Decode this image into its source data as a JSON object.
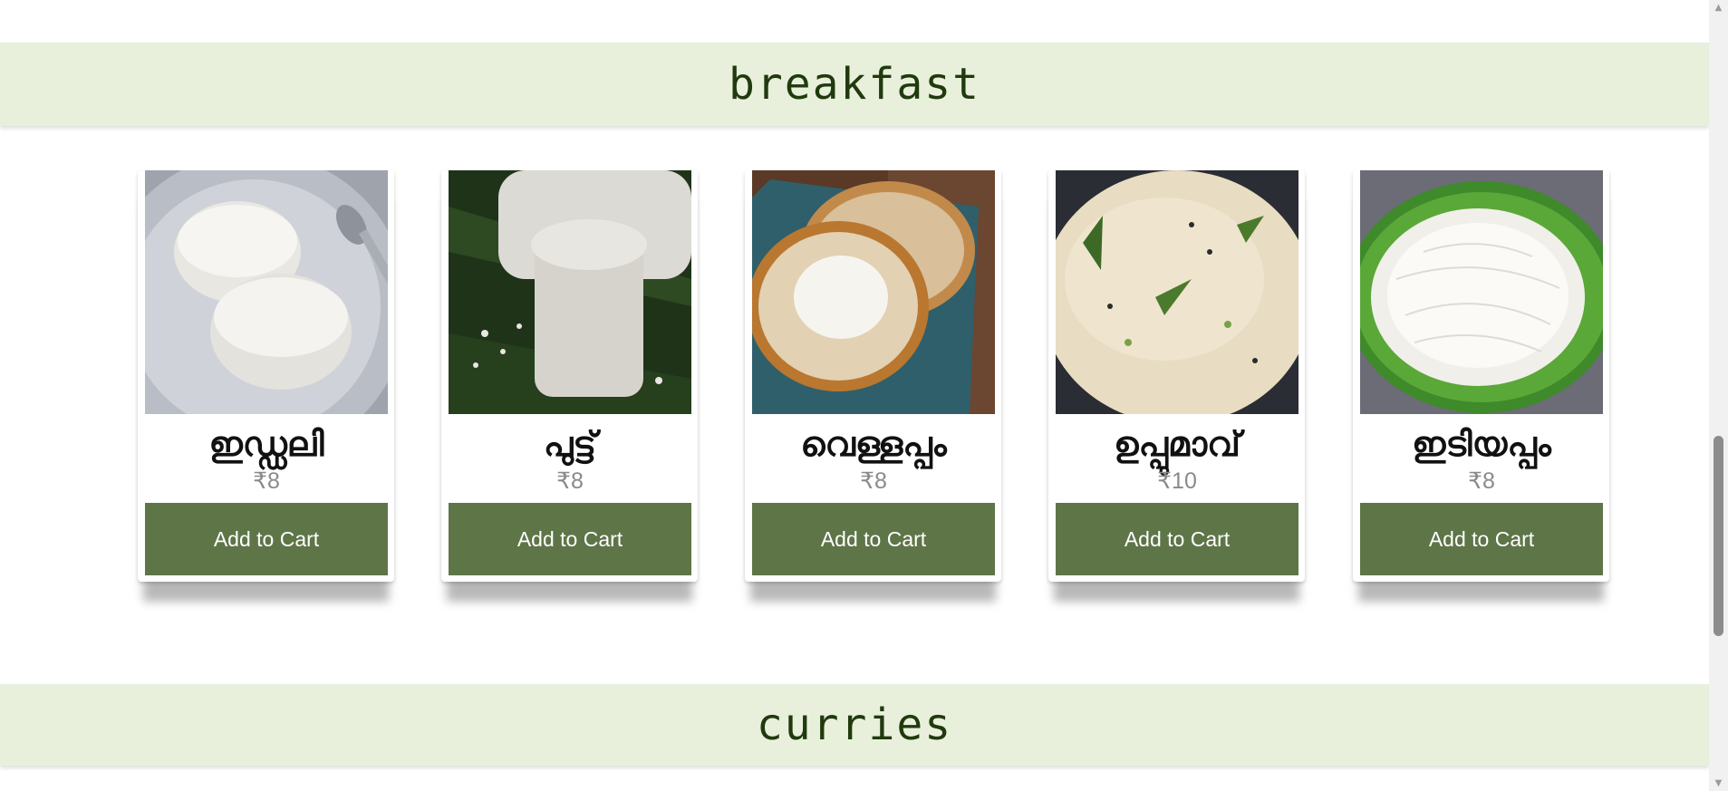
{
  "sections": {
    "breakfast": {
      "title": "breakfast"
    },
    "curries": {
      "title": "curries"
    }
  },
  "items": [
    {
      "name": "ഇഡ്ഡലി",
      "price": "₹8",
      "button": "Add to Cart",
      "image": "idli-photo"
    },
    {
      "name": "പുട്ട്",
      "price": "₹8",
      "button": "Add to Cart",
      "image": "puttu-photo"
    },
    {
      "name": "വെള്ളപ്പം",
      "price": "₹8",
      "button": "Add to Cart",
      "image": "vellappam-photo"
    },
    {
      "name": "ഉപ്പുമാവ്",
      "price": "₹10",
      "button": "Add to Cart",
      "image": "upma-photo"
    },
    {
      "name": "ഇടിയപ്പം",
      "price": "₹8",
      "button": "Add to Cart",
      "image": "idiyappam-photo"
    }
  ],
  "colors": {
    "banner_bg": "#e8f0dc",
    "banner_text": "#203a0e",
    "button_bg": "#5e7548",
    "button_text": "#ffffff",
    "price_text": "#8a8a8a"
  }
}
